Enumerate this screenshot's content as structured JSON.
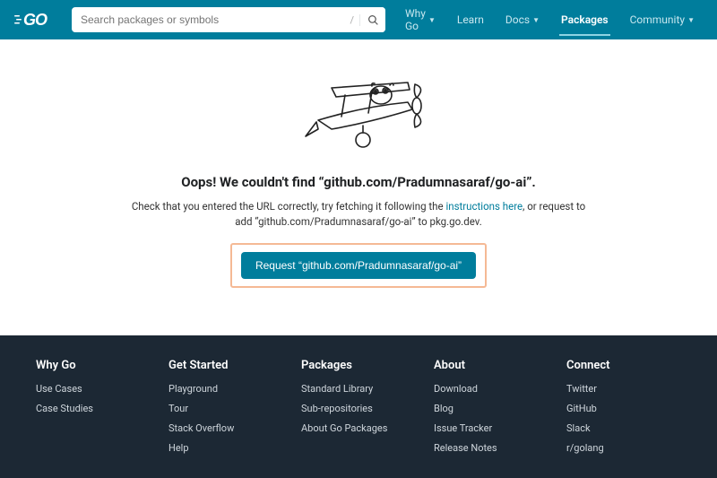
{
  "header": {
    "search_placeholder": "Search packages or symbols",
    "nav": [
      {
        "label": "Why Go",
        "dropdown": true,
        "active": false
      },
      {
        "label": "Learn",
        "dropdown": false,
        "active": false
      },
      {
        "label": "Docs",
        "dropdown": true,
        "active": false
      },
      {
        "label": "Packages",
        "dropdown": false,
        "active": true
      },
      {
        "label": "Community",
        "dropdown": true,
        "active": false
      }
    ]
  },
  "main": {
    "headline": "Oops! We couldn't find “github.com/Pradumnasaraf/go-ai”.",
    "sub_pre": "Check that you entered the URL correctly, try fetching it following the ",
    "sub_link": "instructions here",
    "sub_post": ", or request to add “github.com/Pradumnasaraf/go-ai” to pkg.go.dev.",
    "cta_label": "Request “github.com/Pradumnasaraf/go-ai”"
  },
  "footer": {
    "columns": [
      {
        "title": "Why Go",
        "links": [
          "Use Cases",
          "Case Studies"
        ]
      },
      {
        "title": "Get Started",
        "links": [
          "Playground",
          "Tour",
          "Stack Overflow",
          "Help"
        ]
      },
      {
        "title": "Packages",
        "links": [
          "Standard Library",
          "Sub-repositories",
          "About Go Packages"
        ]
      },
      {
        "title": "About",
        "links": [
          "Download",
          "Blog",
          "Issue Tracker",
          "Release Notes"
        ]
      },
      {
        "title": "Connect",
        "links": [
          "Twitter",
          "GitHub",
          "Slack",
          "r/golang"
        ]
      }
    ]
  }
}
